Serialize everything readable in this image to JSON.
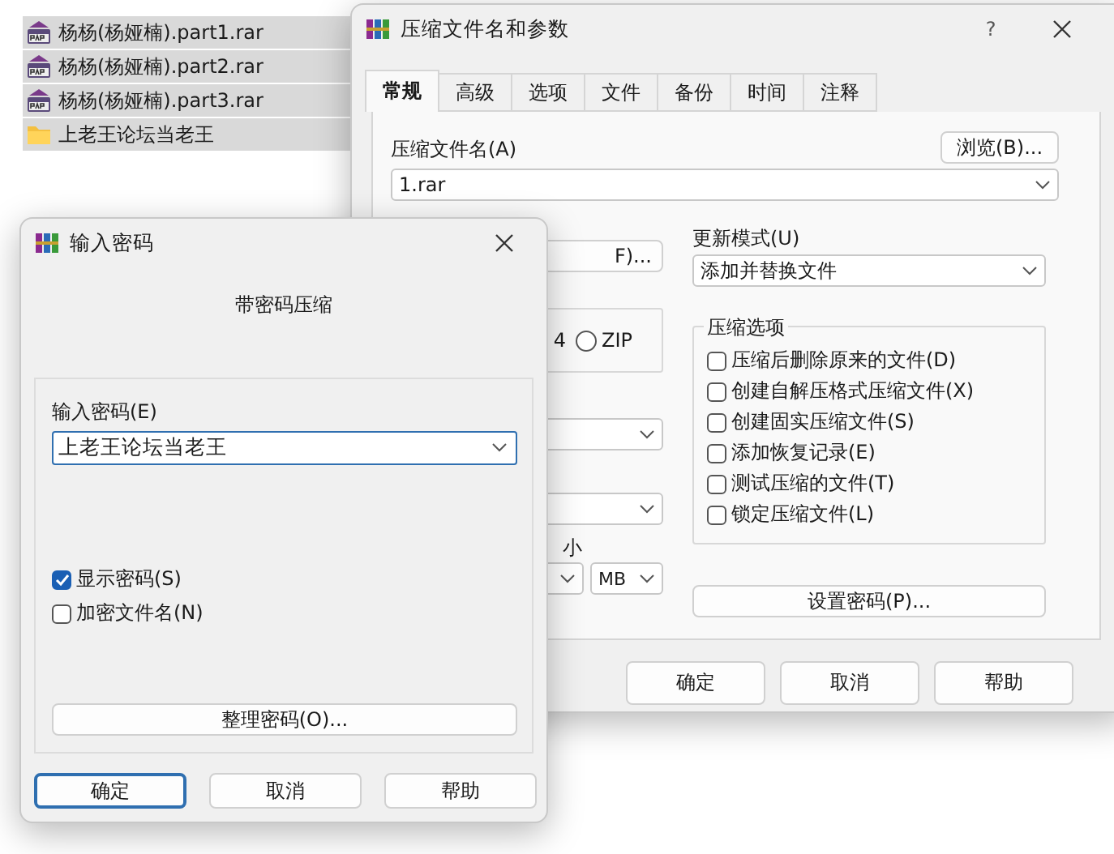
{
  "files": [
    {
      "name": "杨杨(杨娅楠).part1.rar",
      "kind": "rar"
    },
    {
      "name": "杨杨(杨娅楠).part2.rar",
      "kind": "rar"
    },
    {
      "name": "杨杨(杨娅楠).part3.rar",
      "kind": "rar"
    },
    {
      "name": "上老王论坛当老王",
      "kind": "folder"
    }
  ],
  "archive_dialog": {
    "title": "压缩文件名和参数",
    "help": "?",
    "tabs": [
      {
        "label": "常规",
        "selected": true
      },
      {
        "label": "高级",
        "selected": false
      },
      {
        "label": "选项",
        "selected": false
      },
      {
        "label": "文件",
        "selected": false
      },
      {
        "label": "备份",
        "selected": false
      },
      {
        "label": "时间",
        "selected": false
      },
      {
        "label": "注释",
        "selected": false
      }
    ],
    "archive_name_label": "压缩文件名(A)",
    "browse_button": "浏览(B)...",
    "archive_name": "1.rar",
    "profiles_button_fragment": "F)...",
    "update_mode_label": "更新模式(U)",
    "update_mode": "添加并替换文件",
    "format_label_fragment": "4",
    "format_option": {
      "label": "ZIP",
      "selected": false
    },
    "size_label_fragment": "小",
    "size_unit": "MB",
    "options_title": "压缩选项",
    "options": [
      {
        "label": "压缩后删除原来的文件(D)",
        "checked": false
      },
      {
        "label": "创建自解压格式压缩文件(X)",
        "checked": false
      },
      {
        "label": "创建固实压缩文件(S)",
        "checked": false
      },
      {
        "label": "添加恢复记录(E)",
        "checked": false
      },
      {
        "label": "测试压缩的文件(T)",
        "checked": false
      },
      {
        "label": "锁定压缩文件(L)",
        "checked": false
      }
    ],
    "set_password_button": "设置密码(P)...",
    "buttons": [
      "确定",
      "取消",
      "帮助"
    ]
  },
  "password_dialog": {
    "title": "输入密码",
    "heading": "带密码压缩",
    "password_label": "输入密码(E)",
    "password": "上老王论坛当老王",
    "options": [
      {
        "label": "显示密码(S)",
        "checked": true
      },
      {
        "label": "加密文件名(N)",
        "checked": false
      }
    ],
    "organize_button": "整理密码(O)...",
    "buttons": [
      {
        "label": "确定",
        "default": true
      },
      {
        "label": "取消",
        "default": false
      },
      {
        "label": "帮助",
        "default": false
      }
    ]
  }
}
